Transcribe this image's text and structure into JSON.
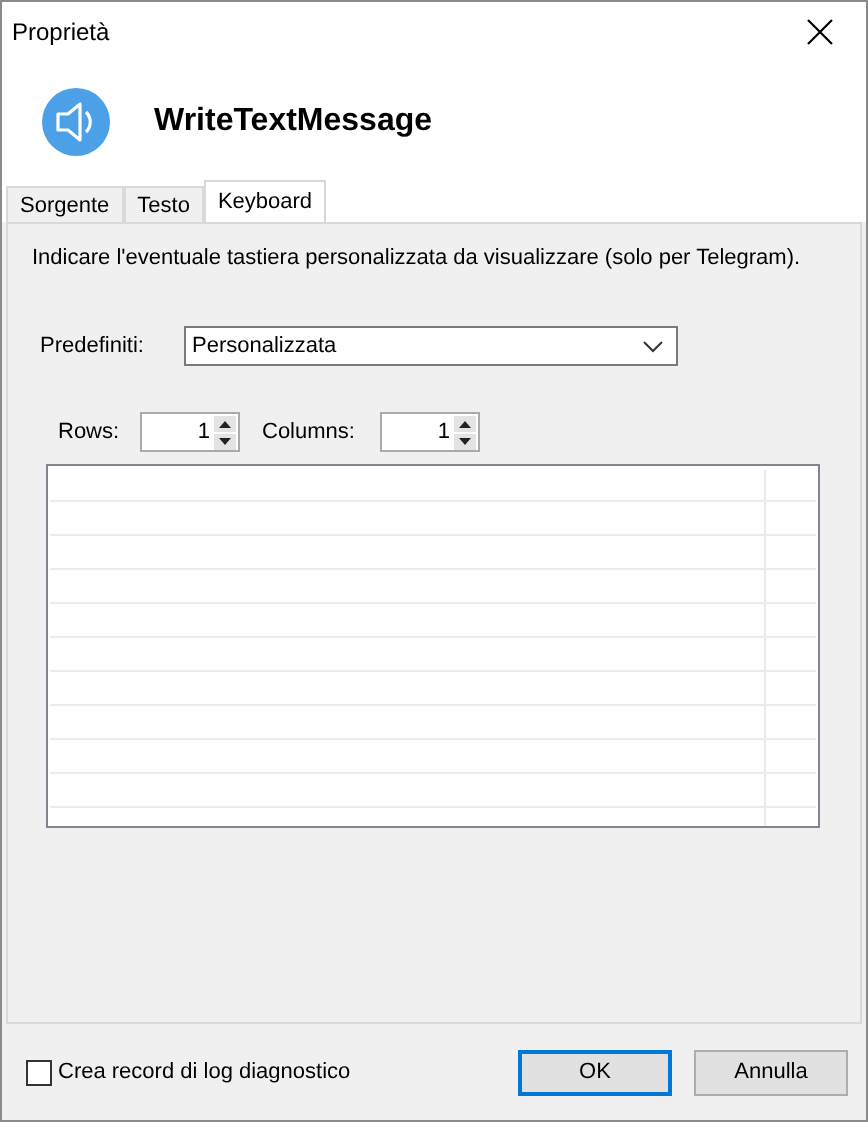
{
  "window": {
    "title": "Proprietà"
  },
  "header": {
    "title": "WriteTextMessage"
  },
  "tabs": [
    {
      "label": "Sorgente",
      "selected": false
    },
    {
      "label": "Testo",
      "selected": false
    },
    {
      "label": "Keyboard",
      "selected": true
    }
  ],
  "description": "Indicare l'eventuale tastiera personalizzata da visualizzare (solo per Telegram).",
  "preset": {
    "label": "Predefiniti:",
    "value": "Personalizzata"
  },
  "rows": {
    "label": "Rows:",
    "value": "1"
  },
  "columns": {
    "label": "Columns:",
    "value": "1"
  },
  "log_checkbox": {
    "label": "Crea record di log diagnostico",
    "checked": false
  },
  "buttons": [
    {
      "label": "OK",
      "default": true
    },
    {
      "label": "Annulla",
      "default": false
    }
  ]
}
